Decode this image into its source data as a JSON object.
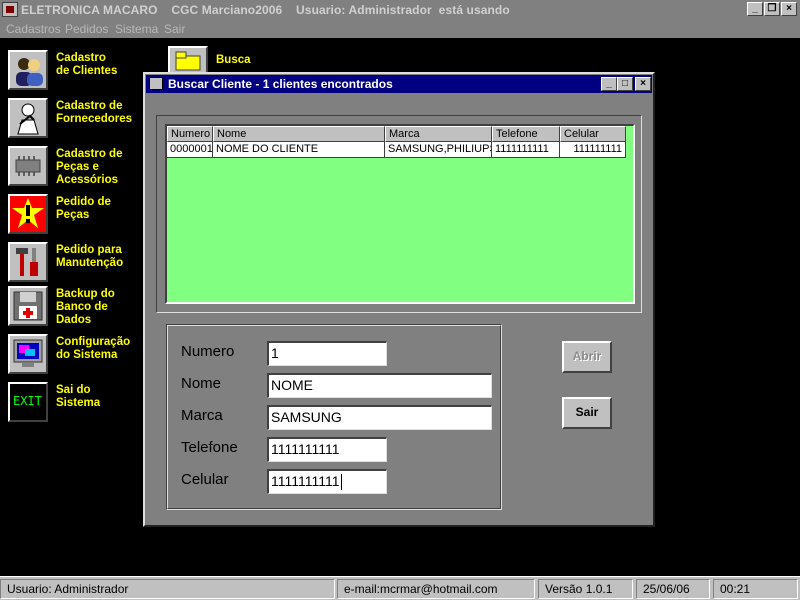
{
  "window": {
    "title": "ELETRONICA MACARO    CGC Marciano2006    Usuario: Administrador  está usando",
    "controls": [
      "_",
      "х",
      "×"
    ]
  },
  "menu": [
    "Cadastros",
    "Pedidos",
    "Sistema",
    "Sair"
  ],
  "left_menu": [
    {
      "label": "Cadastro\nde Clientes",
      "icon": "users-icon"
    },
    {
      "label": "Cadastro de\nFornecedores",
      "icon": "handshake-icon"
    },
    {
      "label": "Cadastro de\nPeças e\nAcessórios",
      "icon": "chip-icon"
    },
    {
      "label": "Pedido de\nPeças",
      "icon": "alert-icon"
    },
    {
      "label": "Pedido para\nManutenção",
      "icon": "tools-icon"
    },
    {
      "label": "Backup do\nBanco de\nDados",
      "icon": "floppy-disk-icon"
    },
    {
      "label": "Configuração\ndo Sistema",
      "icon": "monitor-icon"
    },
    {
      "label": "Sai do\nSistema",
      "icon": "exit-icon",
      "icon_text": "EXIT"
    }
  ],
  "top_button": {
    "label": "Busca",
    "icon": "binoculars-icon"
  },
  "dialog": {
    "title": "Buscar Cliente - 1 clientes encontrados",
    "grid": {
      "background": "#80ff80",
      "columns": [
        "Numero",
        "Nome",
        "Marca",
        "Telefone",
        "Celular"
      ],
      "rows": [
        [
          "0000001",
          "NOME DO CLIENTE",
          "SAMSUNG,PHILIUPS",
          "1111111111",
          "111111111"
        ]
      ]
    },
    "form": {
      "numero": {
        "label": "Numero",
        "value": "1"
      },
      "nome": {
        "label": "Nome",
        "value": "NOME"
      },
      "marca": {
        "label": "Marca",
        "value": "SAMSUNG"
      },
      "telefone": {
        "label": "Telefone",
        "value": "1111111111"
      },
      "celular": {
        "label": "Celular",
        "value": "1111111111"
      }
    },
    "buttons": {
      "abrir": "Abrir",
      "sair": "Sair"
    }
  },
  "status": {
    "user": "Usuario: Administrador",
    "email": "e-mail:mcrmar@hotmail.com",
    "version": "Versão 1.0.1",
    "date": "25/06/06",
    "time": "00:21"
  },
  "colors": {
    "accent_label": "#ffff00",
    "dialog_title": "#000080",
    "desktop": "#000000"
  }
}
